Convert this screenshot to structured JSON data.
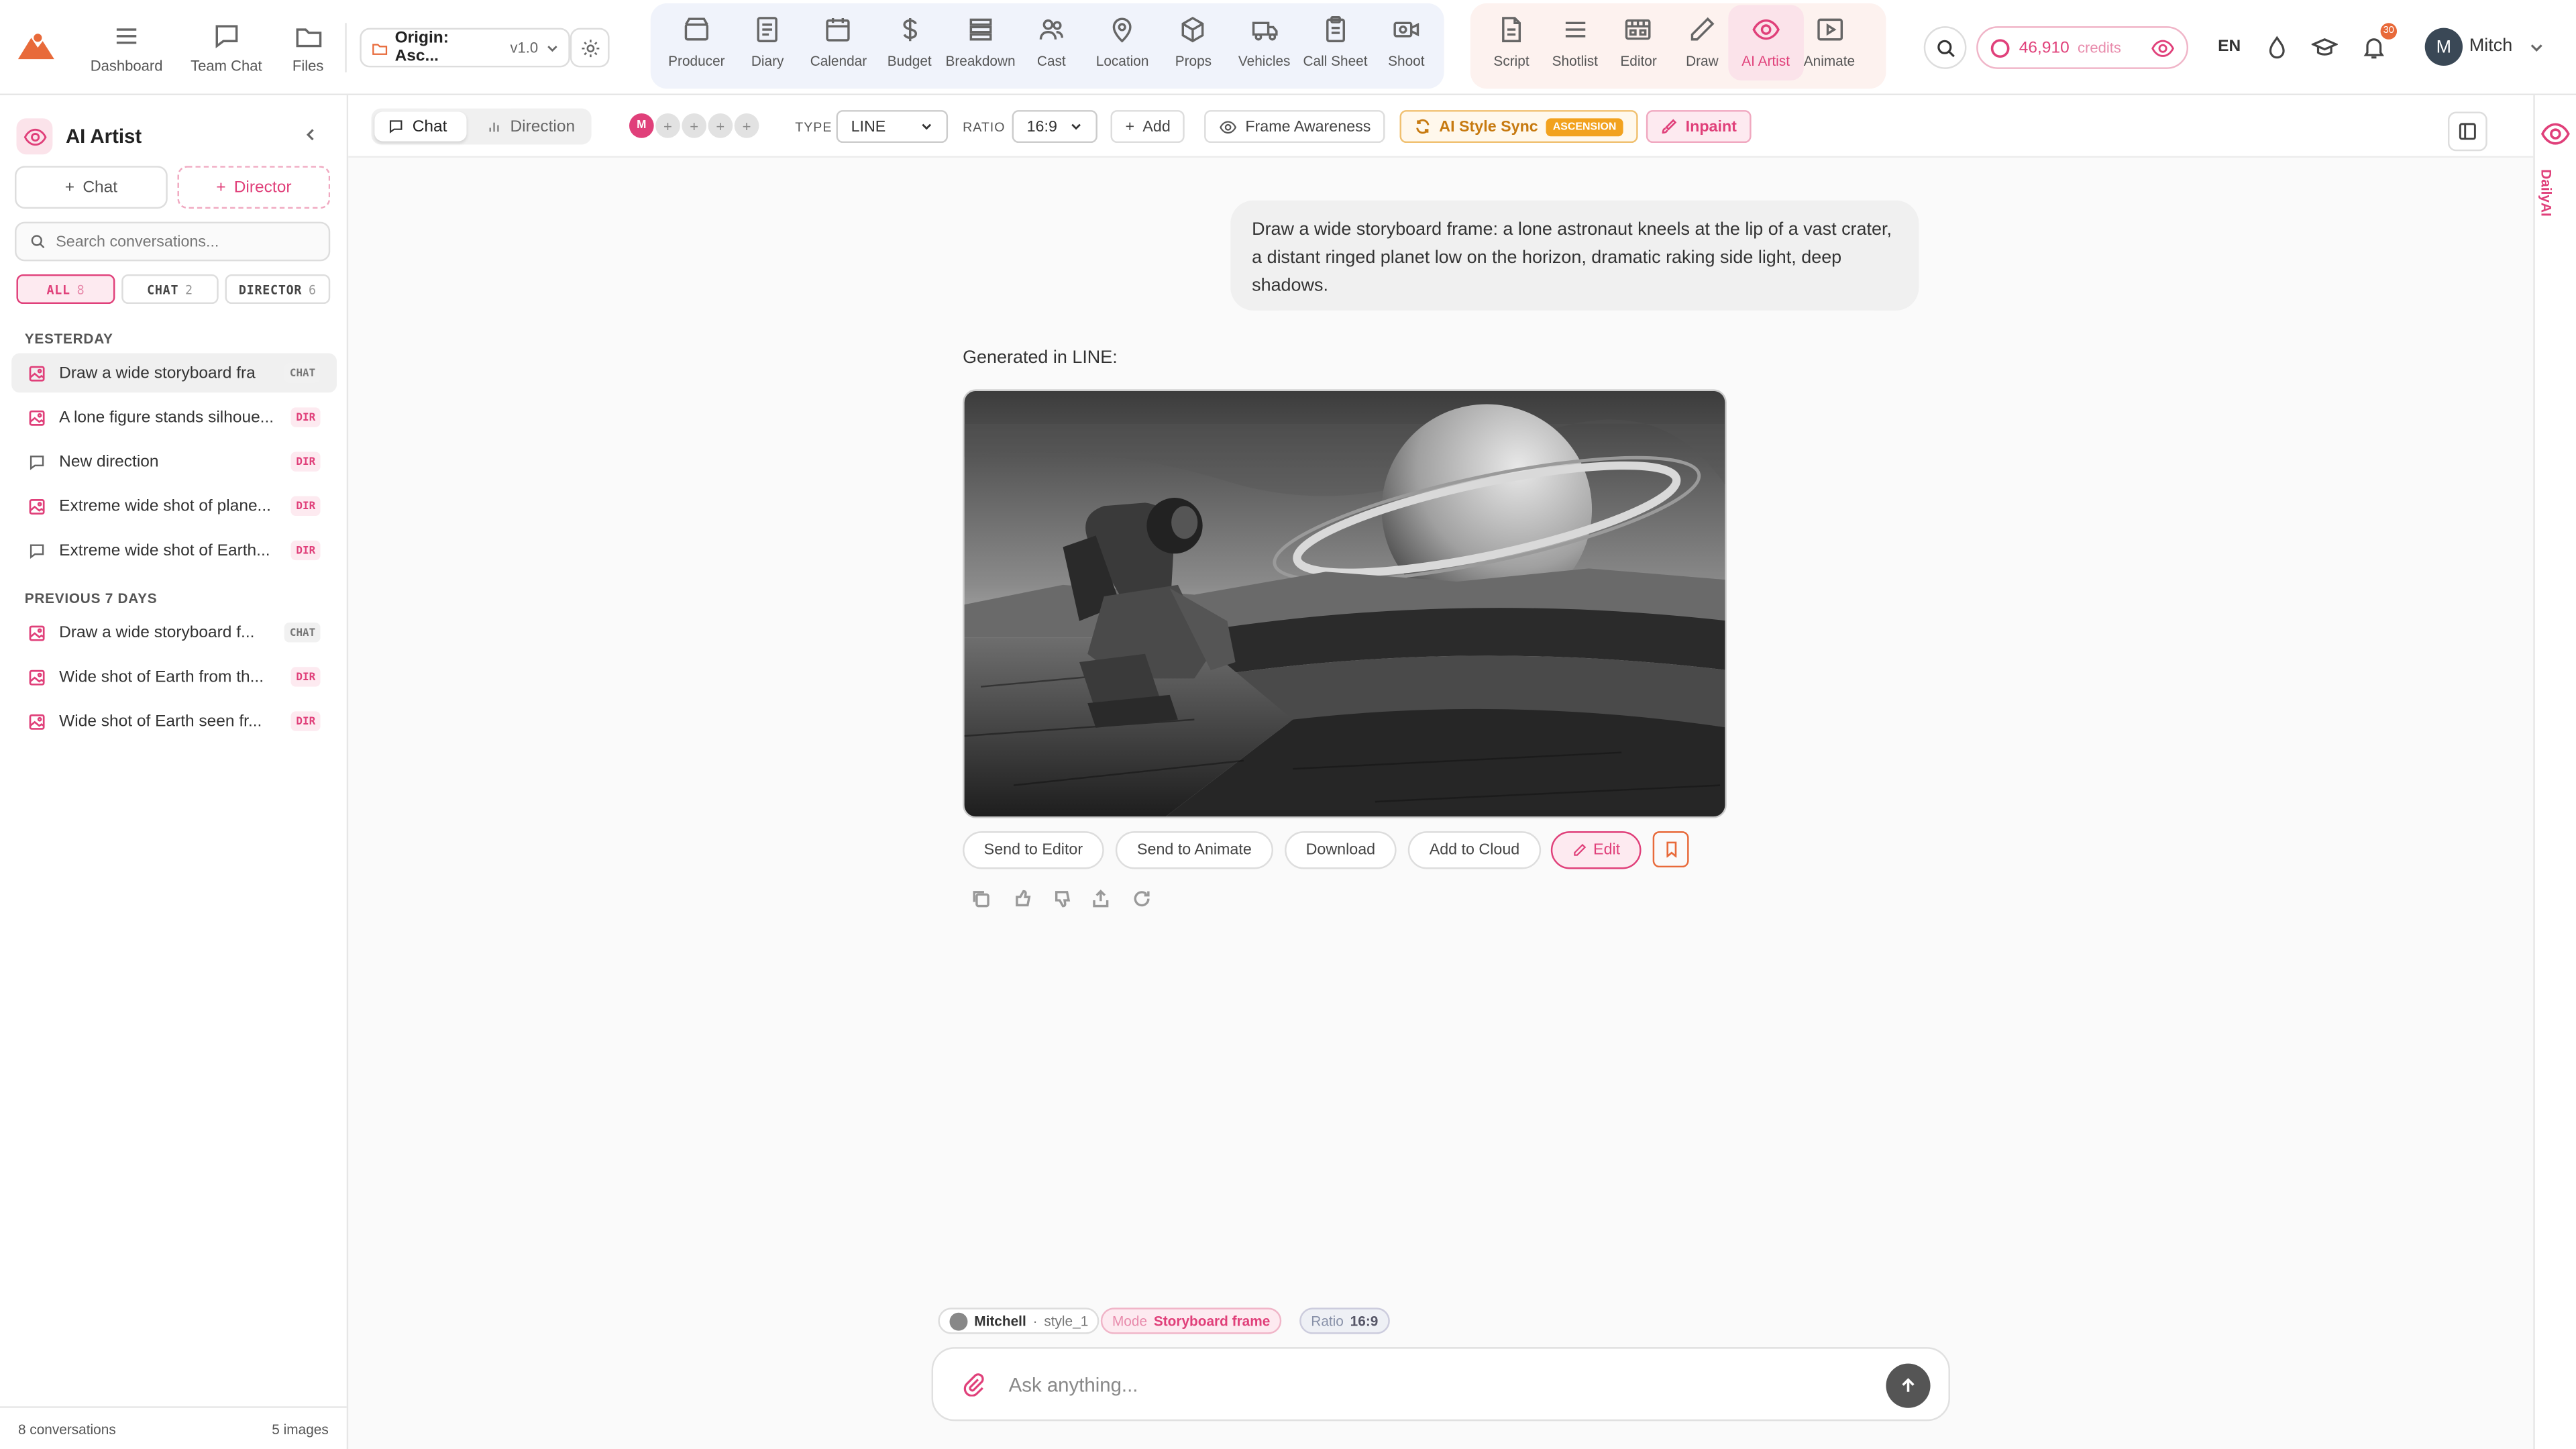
{
  "nav_left": [
    {
      "label": "Dashboard",
      "icon": "menu-icon"
    },
    {
      "label": "Team Chat",
      "icon": "chat-bubble-icon"
    },
    {
      "label": "Files",
      "icon": "folder-icon"
    }
  ],
  "project": {
    "name": "Origin: Asc...",
    "version": "v1.0"
  },
  "group1": [
    {
      "label": "Producer",
      "icon": "clapper-icon"
    },
    {
      "label": "Diary",
      "icon": "diary-icon"
    },
    {
      "label": "Calendar",
      "icon": "calendar-icon"
    },
    {
      "label": "Budget",
      "icon": "dollar-icon"
    },
    {
      "label": "Breakdown",
      "icon": "layers-icon"
    },
    {
      "label": "Cast",
      "icon": "people-icon"
    },
    {
      "label": "Location",
      "icon": "pin-icon"
    },
    {
      "label": "Props",
      "icon": "cube-icon"
    },
    {
      "label": "Vehicles",
      "icon": "truck-icon"
    },
    {
      "label": "Call Sheet",
      "icon": "clipboard-icon"
    },
    {
      "label": "Shoot",
      "icon": "camera-icon"
    }
  ],
  "group2": [
    {
      "label": "Script",
      "icon": "document-icon"
    },
    {
      "label": "Shotlist",
      "icon": "list-icon"
    },
    {
      "label": "Editor",
      "icon": "film-icon"
    },
    {
      "label": "Draw",
      "icon": "pencil-icon"
    },
    {
      "label": "AI Artist",
      "icon": "eye-icon",
      "active": true
    },
    {
      "label": "Animate",
      "icon": "play-icon"
    }
  ],
  "credits": {
    "value": "46,910",
    "label": "credits"
  },
  "language": "EN",
  "notifications": "30",
  "user": {
    "initial": "M",
    "name": "Mitch"
  },
  "sidebar": {
    "title": "AI Artist",
    "new_chat": "Chat",
    "new_director": "Director",
    "search_placeholder": "Search conversations...",
    "filters": [
      {
        "label": "ALL",
        "count": "8"
      },
      {
        "label": "CHAT",
        "count": "2"
      },
      {
        "label": "DIRECTOR",
        "count": "6"
      }
    ],
    "section_yesterday": "YESTERDAY",
    "section_prev": "PREVIOUS 7 DAYS",
    "yesterday": [
      {
        "title": "Draw a wide storyboard fra",
        "tag": "CHAT",
        "icon": "image-icon"
      },
      {
        "title": "A lone figure stands silhoue...",
        "tag": "DIR",
        "icon": "image-icon"
      },
      {
        "title": "New direction",
        "tag": "DIR",
        "icon": "chat-bubble-icon"
      },
      {
        "title": "Extreme wide shot of plane...",
        "tag": "DIR",
        "icon": "image-icon"
      },
      {
        "title": "Extreme wide shot of Earth...",
        "tag": "DIR",
        "icon": "chat-bubble-icon"
      }
    ],
    "previous": [
      {
        "title": "Draw a wide storyboard f...",
        "tag": "CHAT",
        "icon": "image-icon"
      },
      {
        "title": "Wide shot of Earth from th...",
        "tag": "DIR",
        "icon": "image-icon"
      },
      {
        "title": "Wide shot of Earth seen fr...",
        "tag": "DIR",
        "icon": "image-icon"
      }
    ],
    "footer_left": "8 conversations",
    "footer_right": "5 images"
  },
  "toolbar": {
    "tab_chat": "Chat",
    "tab_direction": "Direction",
    "member_initial": "M",
    "type_label": "TYPE",
    "type_value": "LINE",
    "ratio_label": "RATIO",
    "ratio_value": "16:9",
    "add": "Add",
    "frame_awareness": "Frame Awareness",
    "style_sync": "AI Style Sync",
    "style_sync_pill": "ASCENSION",
    "inpaint": "Inpaint"
  },
  "rail_text": "DailyAI",
  "message": {
    "user": "Draw a wide storyboard frame: a lone astronaut kneels at the lip of a vast crater, a distant ringed planet low on the horizon, dramatic raking side light, deep shadows.",
    "reply": "Generated in LINE:",
    "actions": [
      "Send to Editor",
      "Send to Animate",
      "Download",
      "Add to Cloud",
      "Edit"
    ]
  },
  "context": {
    "user": "Mitchell",
    "style": "style_1",
    "mode_label": "Mode",
    "mode_value": "Storyboard frame",
    "ratio_label": "Ratio",
    "ratio_value": "16:9"
  },
  "composer": {
    "placeholder": "Ask anything..."
  },
  "colors": {
    "accent": "#e0407a",
    "orange": "#e86a3a",
    "sync": "#f2a21e"
  }
}
